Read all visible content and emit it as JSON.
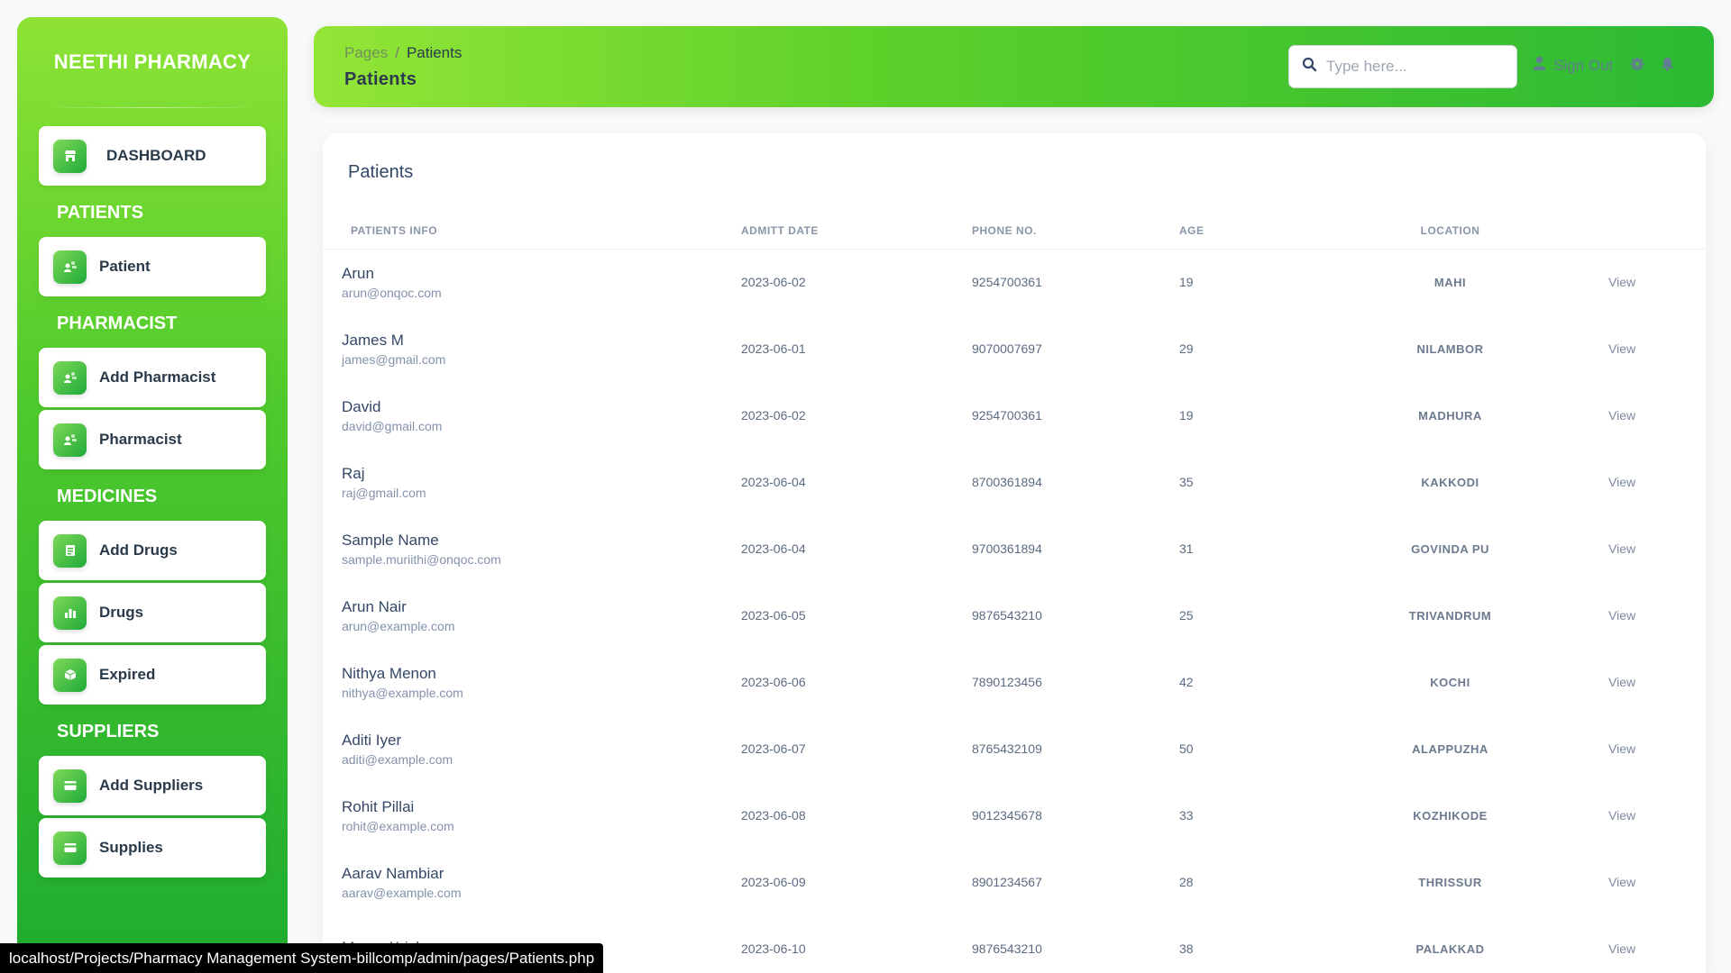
{
  "sidebar": {
    "brand": "NEETHI PHARMACY",
    "dashboard": {
      "label": "DASHBOARD"
    },
    "sections": {
      "patients": {
        "title": "PATIENTS",
        "items": [
          {
            "label": "Patient"
          }
        ]
      },
      "pharmacist": {
        "title": "PHARMACIST",
        "items": [
          {
            "label": "Add Pharmacist"
          },
          {
            "label": "Pharmacist"
          }
        ]
      },
      "medicines": {
        "title": "MEDICINES",
        "items": [
          {
            "label": "Add Drugs"
          },
          {
            "label": "Drugs"
          },
          {
            "label": "Expired"
          }
        ]
      },
      "suppliers": {
        "title": "SUPPLIERS",
        "items": [
          {
            "label": "Add Suppliers"
          },
          {
            "label": "Supplies"
          }
        ]
      }
    }
  },
  "header": {
    "breadcrumb": {
      "root": "Pages",
      "separator": "/",
      "current": "Patients"
    },
    "title": "Patients",
    "search": {
      "placeholder": "Type here...",
      "value": ""
    },
    "signout_label": "Sign Out"
  },
  "main": {
    "card_title": "Patients",
    "columns": [
      "PATIENTS INFO",
      "ADMITT DATE",
      "PHONE NO.",
      "AGE",
      "LOCATION"
    ],
    "rows": [
      {
        "name": "Arun",
        "email": "arun@onqoc.com",
        "date": "2023-06-02",
        "phone": "9254700361",
        "age": "19",
        "location": "MAHI",
        "action": "View"
      },
      {
        "name": "James M",
        "email": "james@gmail.com",
        "date": "2023-06-01",
        "phone": "9070007697",
        "age": "29",
        "location": "NILAMBOR",
        "action": "View"
      },
      {
        "name": "David",
        "email": "david@gmail.com",
        "date": "2023-06-02",
        "phone": "9254700361",
        "age": "19",
        "location": "MADHURA",
        "action": "View"
      },
      {
        "name": "Raj",
        "email": "raj@gmail.com",
        "date": "2023-06-04",
        "phone": "8700361894",
        "age": "35",
        "location": "KAKKODI",
        "action": "View"
      },
      {
        "name": "Sample Name",
        "email": "sample.muriithi@onqoc.com",
        "date": "2023-06-04",
        "phone": "9700361894",
        "age": "31",
        "location": "GOVINDA PU",
        "action": "View"
      },
      {
        "name": "Arun Nair",
        "email": "arun@example.com",
        "date": "2023-06-05",
        "phone": "9876543210",
        "age": "25",
        "location": "TRIVANDRUM",
        "action": "View"
      },
      {
        "name": "Nithya Menon",
        "email": "nithya@example.com",
        "date": "2023-06-06",
        "phone": "7890123456",
        "age": "42",
        "location": "KOCHI",
        "action": "View"
      },
      {
        "name": "Aditi Iyer",
        "email": "aditi@example.com",
        "date": "2023-06-07",
        "phone": "8765432109",
        "age": "50",
        "location": "ALAPPUZHA",
        "action": "View"
      },
      {
        "name": "Rohit Pillai",
        "email": "rohit@example.com",
        "date": "2023-06-08",
        "phone": "9012345678",
        "age": "33",
        "location": "KOZHIKODE",
        "action": "View"
      },
      {
        "name": "Aarav Nambiar",
        "email": "aarav@example.com",
        "date": "2023-06-09",
        "phone": "8901234567",
        "age": "28",
        "location": "THRISSUR",
        "action": "View"
      },
      {
        "name": "Meera Krishnan",
        "email": "",
        "date": "2023-06-10",
        "phone": "9876543210",
        "age": "38",
        "location": "PALAKKAD",
        "action": "View"
      }
    ]
  },
  "status_bar": {
    "url": "localhost/Projects/Pharmacy Management System-billcomp/admin/pages/Patients.php"
  },
  "colors": {
    "accent_green": "#4fca2c",
    "accent_dark_green": "#1faa3a",
    "text_primary": "#344767",
    "text_muted": "#8392ab"
  },
  "icons": {
    "dashboard": "shop-icon",
    "patient": "user-group-icon",
    "pharmacist": "user-group-icon",
    "add_drugs": "document-icon",
    "drugs": "chart-bar-icon",
    "expired": "box-icon",
    "suppliers": "credit-card-icon",
    "search": "search-icon",
    "signout": "user-icon",
    "settings": "gear-icon",
    "notifications": "bell-icon"
  }
}
